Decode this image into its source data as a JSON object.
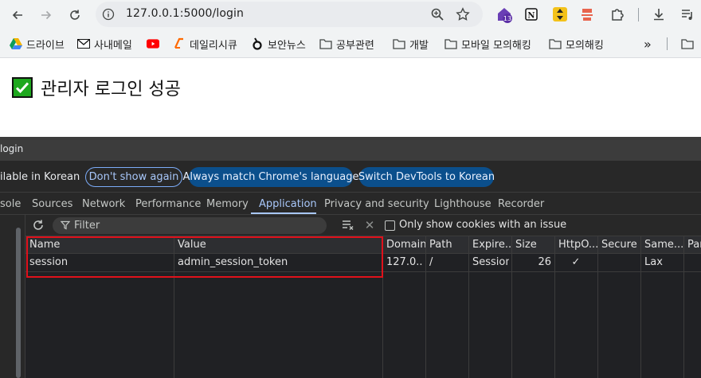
{
  "browser": {
    "url": "127.0.0.1:5000/login",
    "extension_badge": "13"
  },
  "bookmarks": [
    {
      "label": "드라이브",
      "icon": "google-drive-icon"
    },
    {
      "label": "사내메일",
      "icon": "gmail-icon"
    },
    {
      "label": "",
      "icon": "youtube-icon"
    },
    {
      "label": "데일리시큐",
      "icon": "dailysecu-icon"
    },
    {
      "label": "보안뉴스",
      "icon": "boannews-icon"
    },
    {
      "label": "공부관련",
      "icon": "folder-icon"
    },
    {
      "label": "개발",
      "icon": "folder-icon"
    },
    {
      "label": "모바일 모의해킹",
      "icon": "folder-icon"
    },
    {
      "label": "모의해킹",
      "icon": "folder-icon"
    }
  ],
  "page": {
    "success_message": "관리자 로그인 성공"
  },
  "devtools": {
    "title": "login",
    "infobar_message": "ilable in Korean",
    "buttons": {
      "dont_show": "Don't show again",
      "always_match": "Always match Chrome's language",
      "switch": "Switch DevTools to Korean"
    },
    "tabs": [
      "sole",
      "Sources",
      "Network",
      "Performance",
      "Memory",
      "Application",
      "Privacy and security",
      "Lighthouse",
      "Recorder"
    ],
    "active_tab": "Application",
    "filter_placeholder": "Filter",
    "only_issue_label": "Only show cookies with an issue",
    "columns": [
      "Name",
      "Value",
      "Domain",
      "Path",
      "Expire...",
      "Size",
      "HttpO...",
      "Secure",
      "Same...",
      "Par"
    ],
    "rows": [
      {
        "name": "session",
        "value": "admin_session_token",
        "domain": "127.0....",
        "path": "/",
        "expires": "Session",
        "size": "26",
        "httponly": "✓",
        "secure": "",
        "samesite": "Lax",
        "partition": ""
      }
    ]
  },
  "colors": {
    "accent": "#a8c7fa",
    "highlight_border": "#e0111b",
    "success_green": "#1ea81e"
  }
}
